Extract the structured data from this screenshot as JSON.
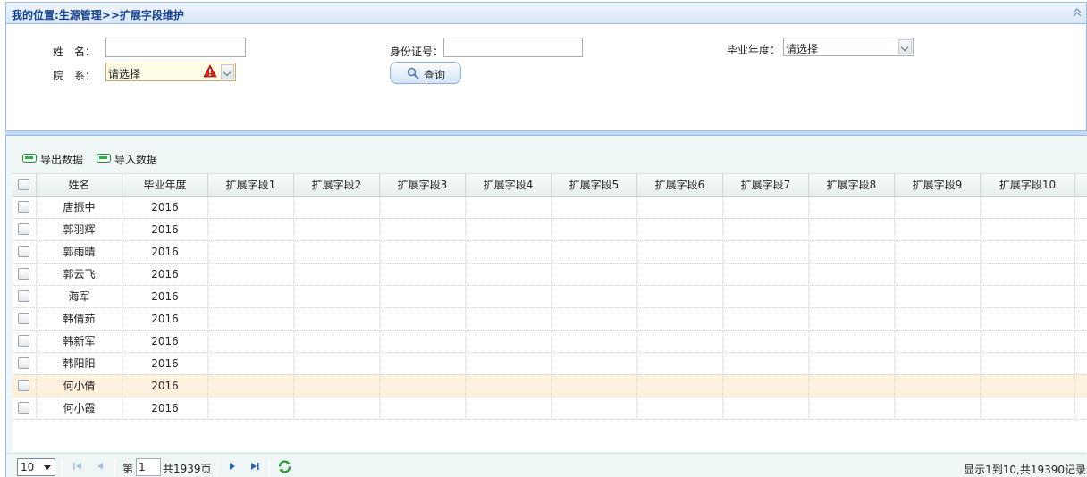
{
  "breadcrumb": "我的位置:生源管理>>扩展字段维护",
  "search": {
    "name_label": "姓　名：",
    "id_label": "身份证号：",
    "year_label": "毕业年度：",
    "year_value": "请选择",
    "dept_label": "院　系：",
    "dept_value": "请选择",
    "query_label": "查询"
  },
  "toolbar": {
    "export_label": "导出数据",
    "import_label": "导入数据"
  },
  "grid": {
    "columns": [
      "姓名",
      "毕业年度",
      "扩展字段1",
      "扩展字段2",
      "扩展字段3",
      "扩展字段4",
      "扩展字段5",
      "扩展字段6",
      "扩展字段7",
      "扩展字段8",
      "扩展字段9",
      "扩展字段10"
    ],
    "rows": [
      {
        "name": "唐振中",
        "year": "2016"
      },
      {
        "name": "郭羽辉",
        "year": "2016"
      },
      {
        "name": "郭雨晴",
        "year": "2016"
      },
      {
        "name": "郭云飞",
        "year": "2016"
      },
      {
        "name": "海军",
        "year": "2016"
      },
      {
        "name": "韩倩茹",
        "year": "2016"
      },
      {
        "name": "韩新军",
        "year": "2016"
      },
      {
        "name": "韩阳阳",
        "year": "2016"
      },
      {
        "name": "何小倩",
        "year": "2016"
      },
      {
        "name": "何小霞",
        "year": "2016"
      }
    ],
    "highlighted_row": 8
  },
  "pager": {
    "page_size": "10",
    "page_prefix": "第",
    "page_current": "1",
    "page_total": "共1939页",
    "info": "显示1到10,共19390记录"
  },
  "colors": {
    "header_text": "#15428b",
    "border": "#99bbe8",
    "row_highlight": "#fdf0dc"
  }
}
